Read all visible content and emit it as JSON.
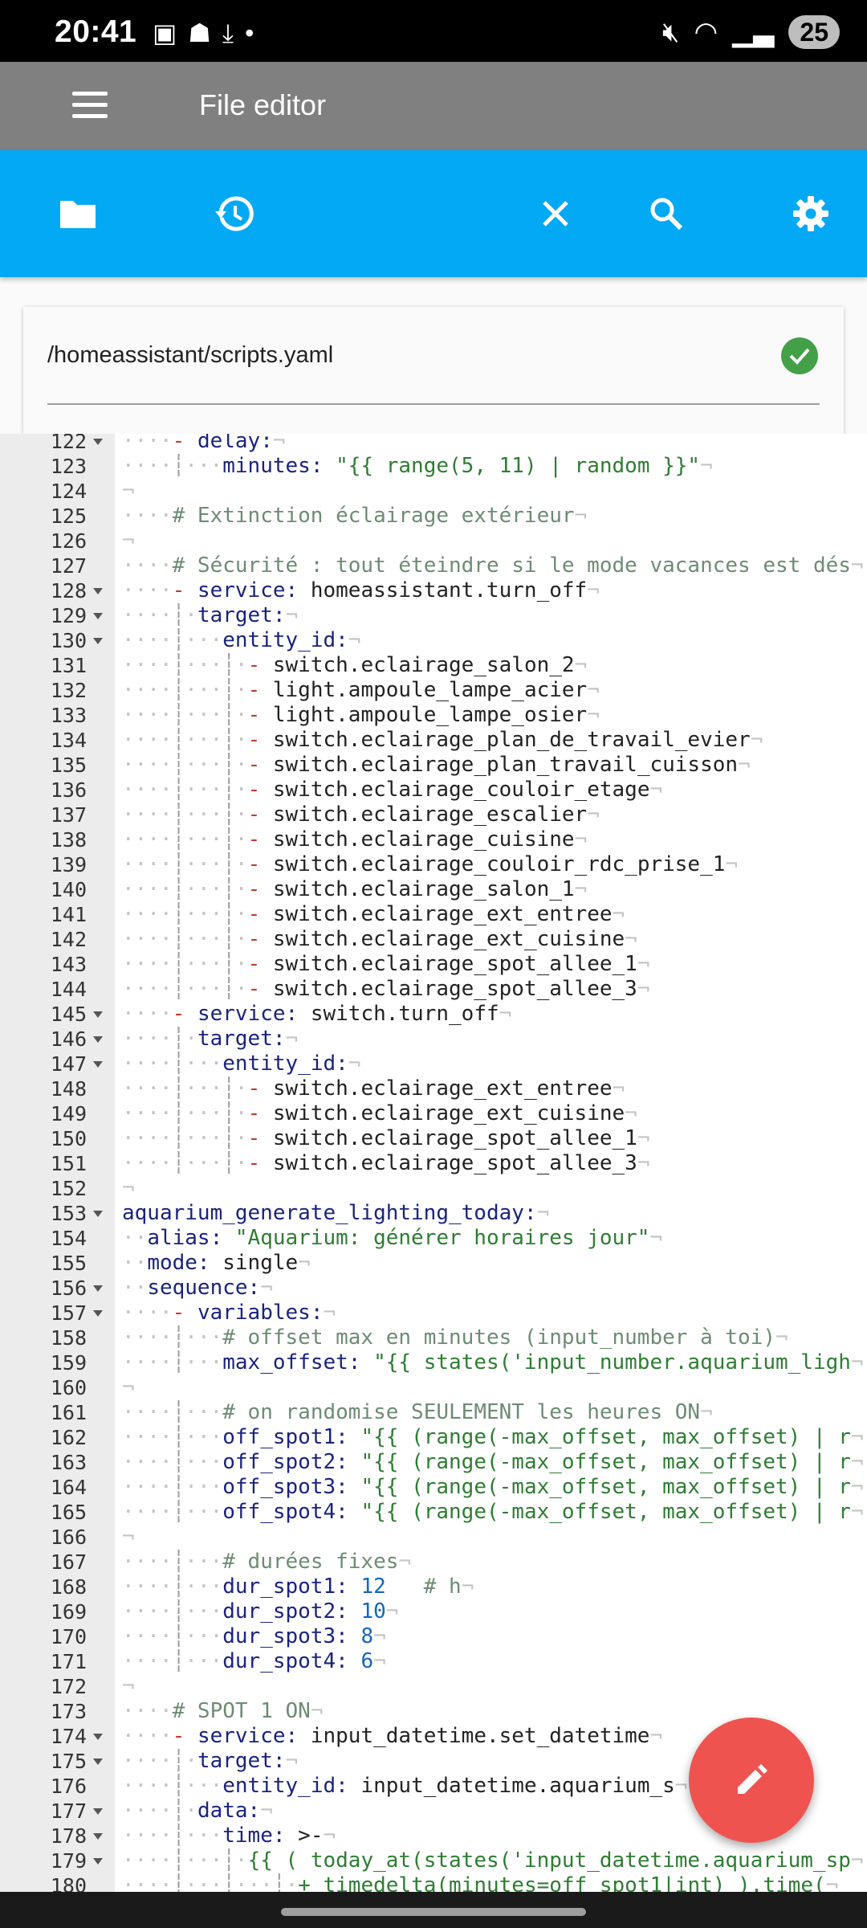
{
  "status_bar": {
    "time": "20:41",
    "battery": "25"
  },
  "header": {
    "title": "File editor"
  },
  "toolbar": {
    "buttons": [
      "folder-icon",
      "history-icon",
      "close-icon",
      "search-icon",
      "settings-icon"
    ]
  },
  "file": {
    "path": "/homeassistant/scripts.yaml"
  },
  "colors": {
    "toolbar": "#03a9f4",
    "header": "#808080",
    "fab": "#ef5350",
    "ok": "#43a047"
  },
  "editor": {
    "lines": [
      {
        "n": "122",
        "fold": true,
        "t": "    - delay:"
      },
      {
        "n": "123",
        "fold": false,
        "t": "        minutes: \"{{ range(5, 11) | random }}\""
      },
      {
        "n": "124",
        "fold": false,
        "t": ""
      },
      {
        "n": "125",
        "fold": false,
        "t": "    # Extinction éclairage extérieur"
      },
      {
        "n": "126",
        "fold": false,
        "t": ""
      },
      {
        "n": "127",
        "fold": false,
        "t": "    # Sécurité : tout éteindre si le mode vacances est dés"
      },
      {
        "n": "128",
        "fold": true,
        "t": "    - service: homeassistant.turn_off"
      },
      {
        "n": "129",
        "fold": true,
        "t": "      target:"
      },
      {
        "n": "130",
        "fold": true,
        "t": "        entity_id:"
      },
      {
        "n": "131",
        "fold": false,
        "t": "          - switch.eclairage_salon_2"
      },
      {
        "n": "132",
        "fold": false,
        "t": "          - light.ampoule_lampe_acier"
      },
      {
        "n": "133",
        "fold": false,
        "t": "          - light.ampoule_lampe_osier"
      },
      {
        "n": "134",
        "fold": false,
        "t": "          - switch.eclairage_plan_de_travail_evier"
      },
      {
        "n": "135",
        "fold": false,
        "t": "          - switch.eclairage_plan_travail_cuisson"
      },
      {
        "n": "136",
        "fold": false,
        "t": "          - switch.eclairage_couloir_etage"
      },
      {
        "n": "137",
        "fold": false,
        "t": "          - switch.eclairage_escalier"
      },
      {
        "n": "138",
        "fold": false,
        "t": "          - switch.eclairage_cuisine"
      },
      {
        "n": "139",
        "fold": false,
        "t": "          - switch.eclairage_couloir_rdc_prise_1"
      },
      {
        "n": "140",
        "fold": false,
        "t": "          - switch.eclairage_salon_1"
      },
      {
        "n": "141",
        "fold": false,
        "t": "          - switch.eclairage_ext_entree"
      },
      {
        "n": "142",
        "fold": false,
        "t": "          - switch.eclairage_ext_cuisine"
      },
      {
        "n": "143",
        "fold": false,
        "t": "          - switch.eclairage_spot_allee_1"
      },
      {
        "n": "144",
        "fold": false,
        "t": "          - switch.eclairage_spot_allee_3"
      },
      {
        "n": "145",
        "fold": true,
        "t": "    - service: switch.turn_off"
      },
      {
        "n": "146",
        "fold": true,
        "t": "      target:"
      },
      {
        "n": "147",
        "fold": true,
        "t": "        entity_id:"
      },
      {
        "n": "148",
        "fold": false,
        "t": "          - switch.eclairage_ext_entree"
      },
      {
        "n": "149",
        "fold": false,
        "t": "          - switch.eclairage_ext_cuisine"
      },
      {
        "n": "150",
        "fold": false,
        "t": "          - switch.eclairage_spot_allee_1"
      },
      {
        "n": "151",
        "fold": false,
        "t": "          - switch.eclairage_spot_allee_3"
      },
      {
        "n": "152",
        "fold": false,
        "t": ""
      },
      {
        "n": "153",
        "fold": true,
        "t": "aquarium_generate_lighting_today:"
      },
      {
        "n": "154",
        "fold": false,
        "t": "  alias: \"Aquarium: générer horaires jour\""
      },
      {
        "n": "155",
        "fold": false,
        "t": "  mode: single"
      },
      {
        "n": "156",
        "fold": true,
        "t": "  sequence:"
      },
      {
        "n": "157",
        "fold": true,
        "t": "    - variables:"
      },
      {
        "n": "158",
        "fold": false,
        "t": "        # offset max en minutes (input_number à toi)"
      },
      {
        "n": "159",
        "fold": false,
        "t": "        max_offset: \"{{ states('input_number.aquarium_ligh"
      },
      {
        "n": "160",
        "fold": false,
        "t": ""
      },
      {
        "n": "161",
        "fold": false,
        "t": "        # on randomise SEULEMENT les heures ON"
      },
      {
        "n": "162",
        "fold": false,
        "t": "        off_spot1: \"{{ (range(-max_offset, max_offset) | r"
      },
      {
        "n": "163",
        "fold": false,
        "t": "        off_spot2: \"{{ (range(-max_offset, max_offset) | r"
      },
      {
        "n": "164",
        "fold": false,
        "t": "        off_spot3: \"{{ (range(-max_offset, max_offset) | r"
      },
      {
        "n": "165",
        "fold": false,
        "t": "        off_spot4: \"{{ (range(-max_offset, max_offset) | r"
      },
      {
        "n": "166",
        "fold": false,
        "t": ""
      },
      {
        "n": "167",
        "fold": false,
        "t": "        # durées fixes"
      },
      {
        "n": "168",
        "fold": false,
        "t": "        dur_spot1: 12   # h"
      },
      {
        "n": "169",
        "fold": false,
        "t": "        dur_spot2: 10"
      },
      {
        "n": "170",
        "fold": false,
        "t": "        dur_spot3: 8"
      },
      {
        "n": "171",
        "fold": false,
        "t": "        dur_spot4: 6"
      },
      {
        "n": "172",
        "fold": false,
        "t": ""
      },
      {
        "n": "173",
        "fold": false,
        "t": "    # SPOT 1 ON"
      },
      {
        "n": "174",
        "fold": true,
        "t": "    - service: input_datetime.set_datetime"
      },
      {
        "n": "175",
        "fold": true,
        "t": "      target:"
      },
      {
        "n": "176",
        "fold": false,
        "t": "        entity_id: input_datetime.aquarium_s"
      },
      {
        "n": "177",
        "fold": true,
        "t": "      data:"
      },
      {
        "n": "178",
        "fold": true,
        "t": "        time: >-"
      },
      {
        "n": "179",
        "fold": true,
        "t": "          {{ ( today_at(states('input_datetime.aquarium_sp"
      },
      {
        "n": "180",
        "fold": false,
        "t": "              + timedelta(minutes=off_spot1|int) ).time("
      }
    ]
  }
}
